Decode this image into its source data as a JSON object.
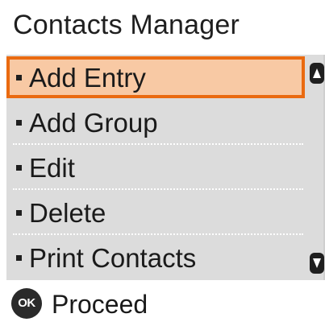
{
  "header": {
    "title": "Contacts Manager"
  },
  "menu": {
    "items": [
      {
        "label": "Add Entry",
        "selected": true
      },
      {
        "label": "Add Group",
        "selected": false
      },
      {
        "label": "Edit",
        "selected": false
      },
      {
        "label": "Delete",
        "selected": false
      },
      {
        "label": "Print Contacts",
        "selected": false
      }
    ],
    "scroll_up_icon": "triangle-up-icon",
    "scroll_down_icon": "triangle-down-icon"
  },
  "footer": {
    "ok_icon_text": "OK",
    "action_label": "Proceed"
  },
  "colors": {
    "selection_fill": "#f8c9a4",
    "selection_border": "#ea6a10",
    "panel_background": "#dcdcdc"
  }
}
